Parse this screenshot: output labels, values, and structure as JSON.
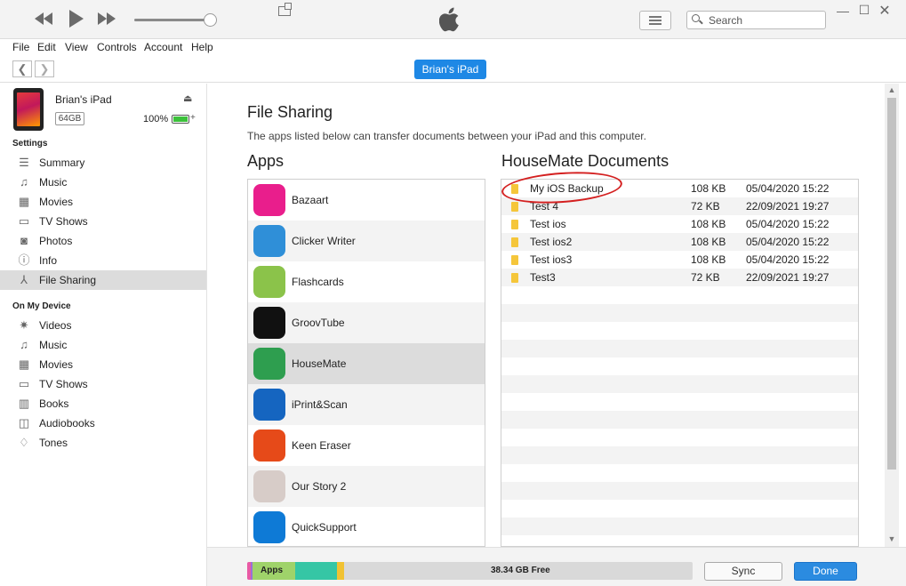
{
  "toolbar": {
    "rewind_icon": "rewind-icon",
    "play_icon": "play-icon",
    "forward_icon": "fast-forward-icon",
    "search_placeholder": "Search"
  },
  "menu": [
    "File",
    "Edit",
    "View",
    "Controls",
    "Account",
    "Help"
  ],
  "nav": {
    "device_button": "Brian's iPad"
  },
  "device": {
    "name": "Brian's iPad",
    "capacity": "64GB",
    "battery_percent": "100%",
    "battery_level": 1.0
  },
  "sidebar": {
    "settings_heading": "Settings",
    "settings_items": [
      {
        "label": "Summary",
        "icon": "summary-icon"
      },
      {
        "label": "Music",
        "icon": "music-icon"
      },
      {
        "label": "Movies",
        "icon": "movies-icon"
      },
      {
        "label": "TV Shows",
        "icon": "tv-icon"
      },
      {
        "label": "Photos",
        "icon": "camera-icon"
      },
      {
        "label": "Info",
        "icon": "info-icon"
      },
      {
        "label": "File Sharing",
        "icon": "file-sharing-icon",
        "selected": true
      }
    ],
    "device_heading": "On My Device",
    "device_items": [
      {
        "label": "Videos",
        "icon": "gear-icon"
      },
      {
        "label": "Music",
        "icon": "music-icon"
      },
      {
        "label": "Movies",
        "icon": "movies-icon"
      },
      {
        "label": "TV Shows",
        "icon": "tv-icon"
      },
      {
        "label": "Books",
        "icon": "books-icon"
      },
      {
        "label": "Audiobooks",
        "icon": "audiobook-icon"
      },
      {
        "label": "Tones",
        "icon": "bell-icon"
      }
    ]
  },
  "main": {
    "title": "File Sharing",
    "description": "The apps listed below can transfer documents between your iPad and this computer.",
    "apps_heading": "Apps",
    "docs_heading": "HouseMate Documents",
    "apps": [
      {
        "name": "Bazaart",
        "color": "#e91e8c"
      },
      {
        "name": "Clicker Writer",
        "color": "#2f8fd8"
      },
      {
        "name": "Flashcards",
        "color": "#8bc34a"
      },
      {
        "name": "GroovTube",
        "color": "#111111"
      },
      {
        "name": "HouseMate",
        "color": "#2e9e4f",
        "selected": true
      },
      {
        "name": "iPrint&Scan",
        "color": "#1565c0"
      },
      {
        "name": "Keen Eraser",
        "color": "#e64a19"
      },
      {
        "name": "Our Story 2",
        "color": "#d7ccc8"
      },
      {
        "name": "QuickSupport",
        "color": "#0e7ad6"
      }
    ],
    "documents": [
      {
        "name": "My iOS Backup",
        "size": "108 KB",
        "date": "05/04/2020 15:22"
      },
      {
        "name": "Test 4",
        "size": "72 KB",
        "date": "22/09/2021 19:27"
      },
      {
        "name": "Test ios",
        "size": "108 KB",
        "date": "05/04/2020 15:22"
      },
      {
        "name": "Test ios2",
        "size": "108 KB",
        "date": "05/04/2020 15:22"
      },
      {
        "name": "Test ios3",
        "size": "108 KB",
        "date": "05/04/2020 15:22"
      },
      {
        "name": "Test3",
        "size": "72 KB",
        "date": "22/09/2021 19:27"
      }
    ]
  },
  "footer": {
    "storage_apps_label": "Apps",
    "storage_free_label": "38.34 GB Free",
    "storage_segments": [
      {
        "name": "other-pink",
        "color": "#e85aa5",
        "fraction": 0.008
      },
      {
        "name": "other-purple",
        "color": "#9c6fd6",
        "fraction": 0.004
      },
      {
        "name": "apps",
        "color": "#9fd36a",
        "fraction": 0.095
      },
      {
        "name": "documents",
        "color": "#35c6a5",
        "fraction": 0.095
      },
      {
        "name": "other-yellow",
        "color": "#f1c232",
        "fraction": 0.016
      }
    ],
    "sync_label": "Sync",
    "done_label": "Done"
  },
  "colors": {
    "accent": "#1e88e5",
    "annotation": "#d42020"
  }
}
